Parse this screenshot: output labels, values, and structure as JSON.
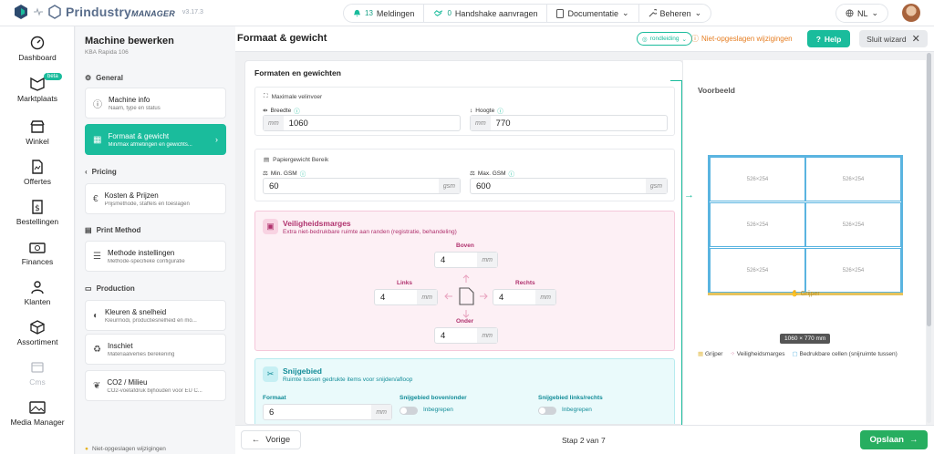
{
  "app": {
    "brand": "Prindustry",
    "brand_suffix": "MANAGER",
    "version": "v3.17.3"
  },
  "topbar": {
    "notifications_count": "13",
    "notifications_label": "Meldingen",
    "handshake_count": "0",
    "handshake_label": "Handshake aanvragen",
    "docs_label": "Documentatie",
    "manage_label": "Beheren",
    "language": "NL"
  },
  "nav": {
    "dashboard": "Dashboard",
    "marketplace": "Marktplaats",
    "beta": "beta",
    "shop": "Winkel",
    "quotes": "Offertes",
    "orders": "Bestellingen",
    "finances": "Finances",
    "customers": "Klanten",
    "assortment": "Assortiment",
    "cms": "Cms",
    "media": "Media Manager"
  },
  "wizard": {
    "title": "Machine bewerken",
    "subtitle": "KBA Rapida 106",
    "sec_general": "General",
    "sec_pricing": "Pricing",
    "sec_print": "Print Method",
    "sec_production": "Production",
    "steps": [
      {
        "title": "Machine info",
        "desc": "Naam, type en status"
      },
      {
        "title": "Formaat & gewicht",
        "desc": "Min/max afmetingen en gewichts..."
      },
      {
        "title": "Kosten & Prijzen",
        "desc": "Prijsmethode, staffels en toeslagen"
      },
      {
        "title": "Methode instellingen",
        "desc": "Methode-specifieke configuratie"
      },
      {
        "title": "Kleuren & snelheid",
        "desc": "Kleurmodi, productiesnelheid en mo..."
      },
      {
        "title": "Inschiet",
        "desc": "Materiaalverlies berekening"
      },
      {
        "title": "CO2 / Milieu",
        "desc": "CO2-voetafdruk bijhouden voor EU C..."
      }
    ],
    "footer": "Niet-opgeslagen wijzigingen"
  },
  "header": {
    "title": "Formaat & gewicht",
    "guide": "rondleiding",
    "unsaved": "Niet-opgeslagen wijzigingen",
    "help": "Help",
    "close": "Sluit wizard"
  },
  "form": {
    "title": "Formaten en gewichten",
    "max_sheet": "Maximale velinvoer",
    "width_label": "Breedte",
    "width_unit": "mm",
    "width_value": "1060",
    "height_label": "Hoogte",
    "height_unit": "mm",
    "height_value": "770",
    "paper_weight": "Papiergewicht Bereik",
    "min_gsm_label": "Min. GSM",
    "min_gsm_value": "60",
    "gsm_unit": "gsm",
    "max_gsm_label": "Max. GSM",
    "max_gsm_value": "600",
    "margins_title": "Veiligheidsmarges",
    "margins_desc": "Extra niet-bedrukbare ruimte aan randen (registratie, behandeling)",
    "top_label": "Boven",
    "top_value": "4",
    "left_label": "Links",
    "left_value": "4",
    "right_label": "Rechts",
    "right_value": "4",
    "bottom_label": "Onder",
    "bottom_value": "4",
    "mm": "mm",
    "cut_title": "Snijgebied",
    "cut_desc": "Ruimte tussen gedrukte items voor snijden/afloop",
    "format_label": "Formaat",
    "format_value": "6",
    "cut_tb_label": "Snijgebied boven/onder",
    "cut_tb_value": "Inbegrepen",
    "cut_lr_label": "Snijgebied links/rechts",
    "cut_lr_value": "Inbegrepen"
  },
  "preview": {
    "title": "Voorbeeld",
    "cells": [
      "526×254",
      "526×254",
      "526×254",
      "526×254",
      "526×254",
      "526×254"
    ],
    "gripper": "Grijper",
    "dimension": "1060 × 770 mm",
    "legend_gripper": "Grijper",
    "legend_margins": "Veiligheidsmarges",
    "legend_cells": "Bedrukbare cellen (snijruimte tussen)"
  },
  "footer": {
    "prev": "Vorige",
    "step": "Stap 2 van 7",
    "save": "Opslaan"
  },
  "colors": {
    "accent": "#1abc9c",
    "save": "#27ae60",
    "warning": "#e67e22",
    "margin": "#b0326e",
    "cell_border": "#5ab4e0"
  }
}
